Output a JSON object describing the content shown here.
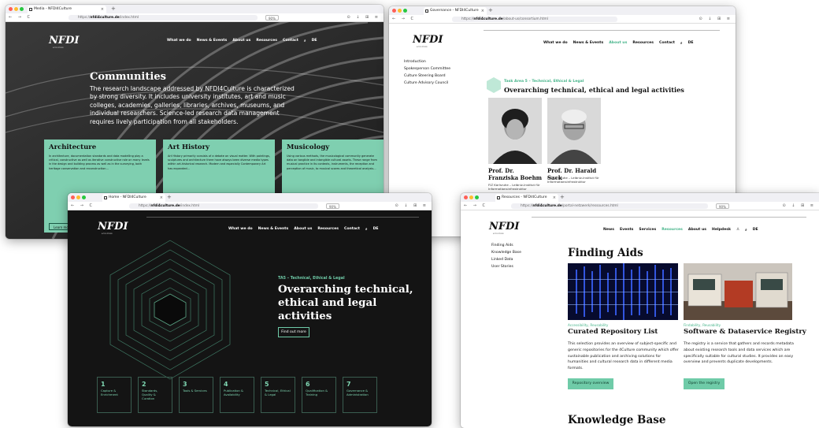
{
  "window_communities": {
    "tab_title": "Media - NFDI4Culture",
    "url_prefix": "https://",
    "url_domain": "nfdi4culture.de",
    "url_path": "/index.html",
    "zoom": "90%",
    "logo": "NFDI",
    "logo_sub": "4CULTURE",
    "nav": [
      "What we do",
      "News & Events",
      "About us",
      "Resources",
      "Contact"
    ],
    "lang": "DE",
    "heading": "Communities",
    "intro": "The research landscape addressed by NFDI4Culture is characterized by strong diversity. It includes university institutes, art and music colleges, academies, galleries, libraries, archives, museums, and individual researchers. Science-led research data management requires lively participation from all stakeholders.",
    "cards": [
      {
        "title": "Architecture",
        "text": "In architecture, documentation standards and data modelling play a critical, constructive as well as iterative constructive role on many levels in the design and building process as well as in the surveying, both heritage conservation and reconstruction...",
        "button": "Learn more"
      },
      {
        "title": "Art History",
        "text": "Art History primarily consists of a debate on visual matter. With paintings, sculptures and architecture there have always been diverse media types within art-historical research. Modern and especially Contemporary Art has expanded...",
        "button": ""
      },
      {
        "title": "Musicology",
        "text": "Using various methods, the musicological community generate data on tangible and intangible cultural assets. These range from musical practice in its contexts, instruments, the reception and perception of music, to musical scores and theoretical analysis...",
        "button": ""
      }
    ]
  },
  "window_governance": {
    "tab_title": "Governance - NFDI4Culture",
    "url_prefix": "https://",
    "url_domain": "nfdi4culture.de",
    "url_path": "/about-us/consortium.html",
    "logo": "NFDI",
    "logo_sub": "4CULTURE",
    "nav": [
      "What we do",
      "News & Events",
      "About us",
      "Resources",
      "Contact"
    ],
    "lang": "DE",
    "sidebar": [
      "Introduction",
      "Spokesperson Committee",
      "Culture Steering Board",
      "Culture Advisory Council"
    ],
    "task_area": "Task Area 5 – Technical, Ethical & Legal",
    "heading": "Overarching technical, ethical and legal activities",
    "people": [
      {
        "name": "Prof. Dr. Franziska Boehm",
        "affiliation": "FIZ Karlsruhe – Leibniz-Institut für Informationsinfrastruktur"
      },
      {
        "name": "Prof. Dr. Harald Sack",
        "affiliation": "FIZ Karlsruhe – Leibniz-Institut für Informationsinfrastruktur"
      }
    ]
  },
  "window_ta5": {
    "tab_title": "Home - NFDI4Culture",
    "url_prefix": "https://",
    "url_domain": "nfdi4culture.de",
    "url_path": "/index.html",
    "zoom": "90%",
    "logo": "NFDI",
    "logo_sub": "4CULTURE",
    "nav": [
      "What we do",
      "News & Events",
      "About us",
      "Resources",
      "Contact"
    ],
    "lang": "DE",
    "kicker": "TA5 – Technical, Ethical & Legal",
    "heading": "Overarching technical, ethical and legal activities",
    "button": "Find out more",
    "task_areas": [
      {
        "num": "1",
        "label": "Capture & Enrichment"
      },
      {
        "num": "2",
        "label": "Standards, Quality & Curation"
      },
      {
        "num": "3",
        "label": "Tools & Services"
      },
      {
        "num": "4",
        "label": "Publication & Availability"
      },
      {
        "num": "5",
        "label": "Technical, Ethical & Legal"
      },
      {
        "num": "6",
        "label": "Qualification & Training"
      },
      {
        "num": "7",
        "label": "Governance & Administration"
      }
    ]
  },
  "window_resources": {
    "tab_title": "Resources - NFDI4Culture",
    "url_prefix": "https://",
    "url_domain": "nfdi4culture.de",
    "url_path": "/portal-netzwerk/ressources.html",
    "zoom": "90%",
    "logo": "NFDI",
    "logo_sub": "4CULTURE",
    "nav": [
      "News",
      "Events",
      "Services",
      "Resources",
      "About us",
      "Helpdesk"
    ],
    "lang": "DE",
    "sidebar": [
      "Finding Aids",
      "Knowledge Base",
      "Linked Data",
      "User Stories"
    ],
    "heading": "Finding Aids",
    "items": [
      {
        "tags": "Accessibility, Reusability",
        "title": "Curated Repository List",
        "text": "This selection provides an overview of subject-specific and generic repositories for the 4Culture community which offer sustainable publication and archiving solutions for humanities and cultural research data in different media formats.",
        "button": "Repository overview"
      },
      {
        "tags": "Findability, Reusability",
        "title": "Software & Dataservice Registry",
        "text": "The registry is a service that gathers and records metadata about existing research tools and data services which are specifically suitable for cultural studies. It provides an easy overview and prevents duplicate developments.",
        "button": "Open the registry"
      }
    ],
    "next_heading": "Knowledge Base"
  },
  "colors": {
    "accent": "#6fcba8",
    "accent_text": "#46b48a",
    "dark_bg": "#141414"
  }
}
